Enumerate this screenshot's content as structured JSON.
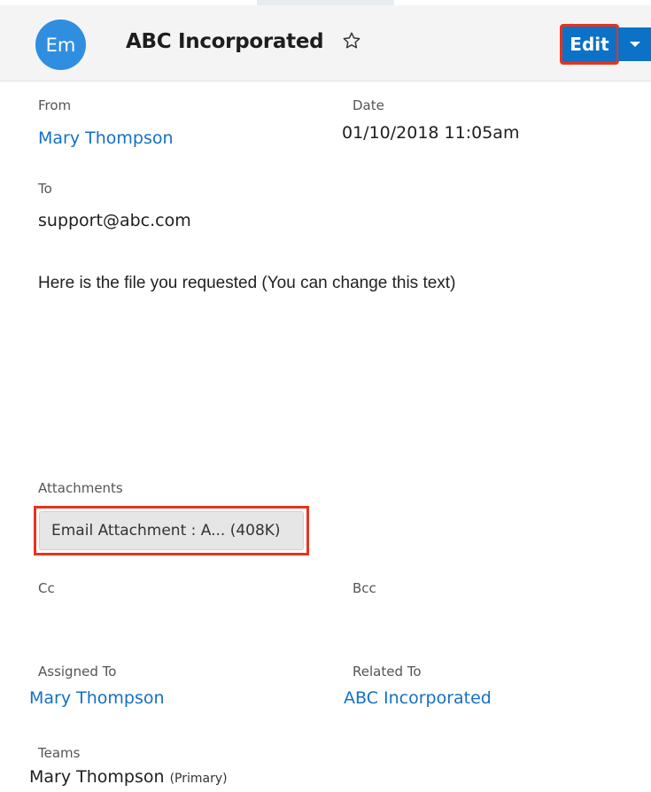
{
  "header": {
    "avatar_text": "Em",
    "title": "ABC Incorporated",
    "edit_label": "Edit",
    "icons": [
      "star-icon",
      "chevron-down-icon"
    ],
    "colors": {
      "accent": "#0b72c7",
      "avatar": "#2f8ee0",
      "highlight": "#e8331c",
      "link": "#1470c4"
    }
  },
  "fields": {
    "from_label": "From",
    "from_value": "Mary Thompson",
    "date_label": "Date",
    "date_value": "01/10/2018 11:05am",
    "to_label": "To",
    "to_value": "support@abc.com",
    "body": "Here is the file you requested (You can change this text)",
    "attachments_label": "Attachments",
    "attachment_value": "Email Attachment : A... (408K)",
    "cc_label": "Cc",
    "bcc_label": "Bcc",
    "assigned_label": "Assigned To",
    "assigned_value": "Mary Thompson",
    "related_label": "Related To",
    "related_value": "ABC Incorporated",
    "teams_label": "Teams",
    "teams_value": "Mary Thompson",
    "teams_primary": "(Primary)"
  }
}
